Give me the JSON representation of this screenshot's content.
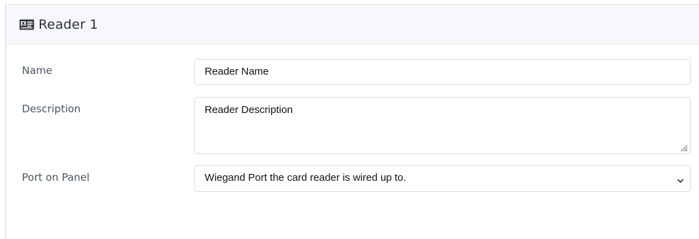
{
  "header": {
    "icon": "id-card-icon",
    "title": "Reader 1"
  },
  "form": {
    "name": {
      "label": "Name",
      "value": "Reader Name"
    },
    "description": {
      "label": "Description",
      "value": "Reader Description"
    },
    "port": {
      "label": "Port on Panel",
      "selected": "Wiegand Port the card reader is wired up to.",
      "dropdown_icon": "chevron-down-icon"
    }
  }
}
